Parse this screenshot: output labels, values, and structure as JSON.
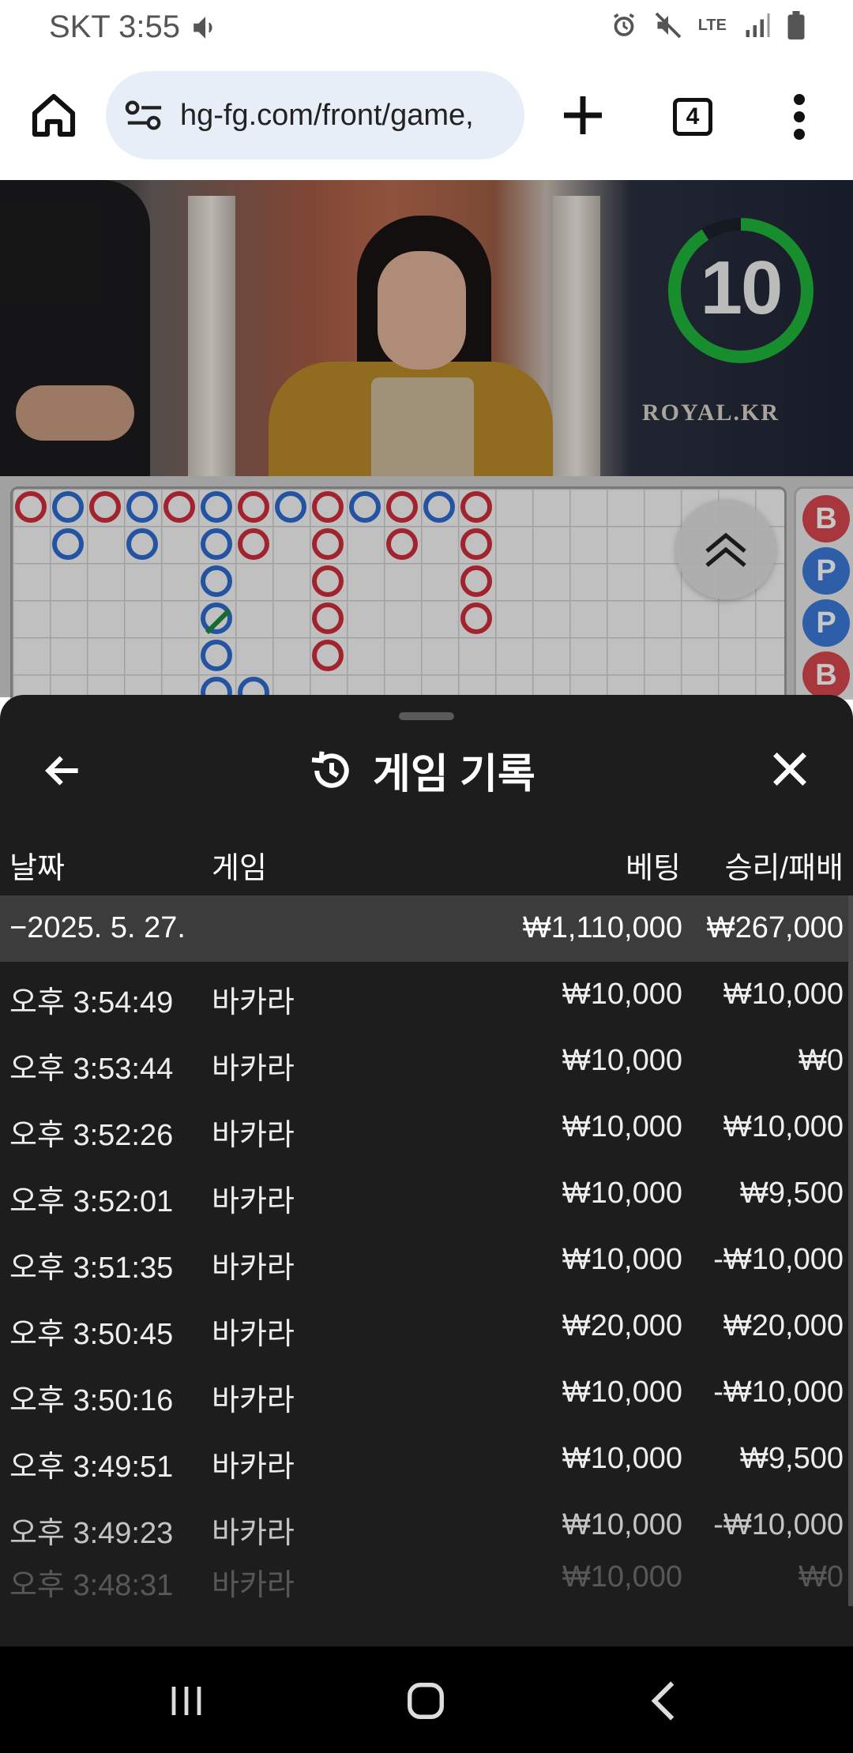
{
  "status_bar": {
    "carrier_time": "SKT 3:55",
    "network": "LTE"
  },
  "browser": {
    "url": "hg-fg.com/front/game,",
    "tab_count": "4"
  },
  "video": {
    "countdown": "10",
    "brand": "ROYAL.KR"
  },
  "roadmap": {
    "side_beads": [
      "B",
      "P",
      "P",
      "B"
    ]
  },
  "history": {
    "title": "게임 기록",
    "columns": {
      "date": "날짜",
      "game": "게임",
      "bet": "베팅",
      "win_loss": "승리/패배"
    },
    "date_group": {
      "date": "−2025. 5. 27.",
      "total_bet": "₩1,110,000",
      "total_win_loss": "₩267,000"
    },
    "rows": [
      {
        "time": "오후 3:54:49",
        "game": "바카라",
        "bet": "₩10,000",
        "win_loss": "₩10,000"
      },
      {
        "time": "오후 3:53:44",
        "game": "바카라",
        "bet": "₩10,000",
        "win_loss": "₩0"
      },
      {
        "time": "오후 3:52:26",
        "game": "바카라",
        "bet": "₩10,000",
        "win_loss": "₩10,000"
      },
      {
        "time": "오후 3:52:01",
        "game": "바카라",
        "bet": "₩10,000",
        "win_loss": "₩9,500"
      },
      {
        "time": "오후 3:51:35",
        "game": "바카라",
        "bet": "₩10,000",
        "win_loss": "-₩10,000"
      },
      {
        "time": "오후 3:50:45",
        "game": "바카라",
        "bet": "₩20,000",
        "win_loss": "₩20,000"
      },
      {
        "time": "오후 3:50:16",
        "game": "바카라",
        "bet": "₩10,000",
        "win_loss": "-₩10,000"
      },
      {
        "time": "오후 3:49:51",
        "game": "바카라",
        "bet": "₩10,000",
        "win_loss": "₩9,500"
      },
      {
        "time": "오후 3:49:23",
        "game": "바카라",
        "bet": "₩10,000",
        "win_loss": "-₩10,000"
      },
      {
        "time": "오후 3:48:31",
        "game": "바카라",
        "bet": "₩10,000",
        "win_loss": "₩0"
      }
    ]
  },
  "colors": {
    "banker_red": "#cf2e3c",
    "player_blue": "#2f6bd0",
    "sheet_bg": "#1d1d1d",
    "timer_green": "#1fb53a"
  }
}
